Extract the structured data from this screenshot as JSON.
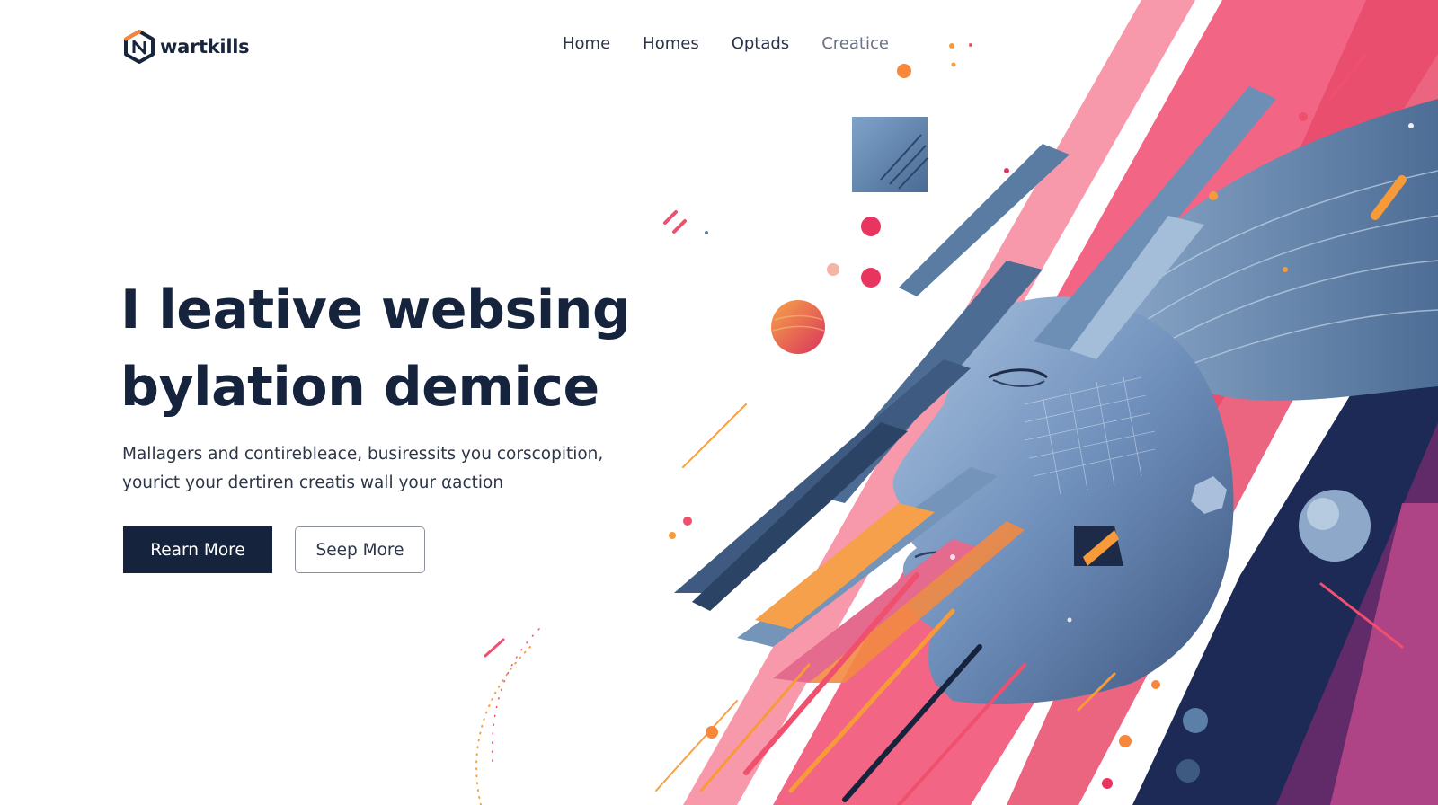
{
  "brand": {
    "name": "wartkills",
    "logo_icon": "hexagon-monogram-icon",
    "colors": {
      "navy": "#15233d",
      "pink": "#f0506e",
      "orange": "#f79a3a",
      "steel": "#5b7fa6"
    }
  },
  "nav": {
    "items": [
      {
        "label": "Home"
      },
      {
        "label": "Homes"
      },
      {
        "label": "Optads"
      },
      {
        "label": "Creatice"
      }
    ]
  },
  "hero": {
    "headline_line1": "I leative websing",
    "headline_line2": "bylation demice",
    "sub_line1": "Mallagers and contirebleace, busiressits you corscopition,",
    "sub_line2": "youriсt your dertiren creatis wall your αaction",
    "primary_button": "Rearn More",
    "secondary_button": "Seep More"
  }
}
